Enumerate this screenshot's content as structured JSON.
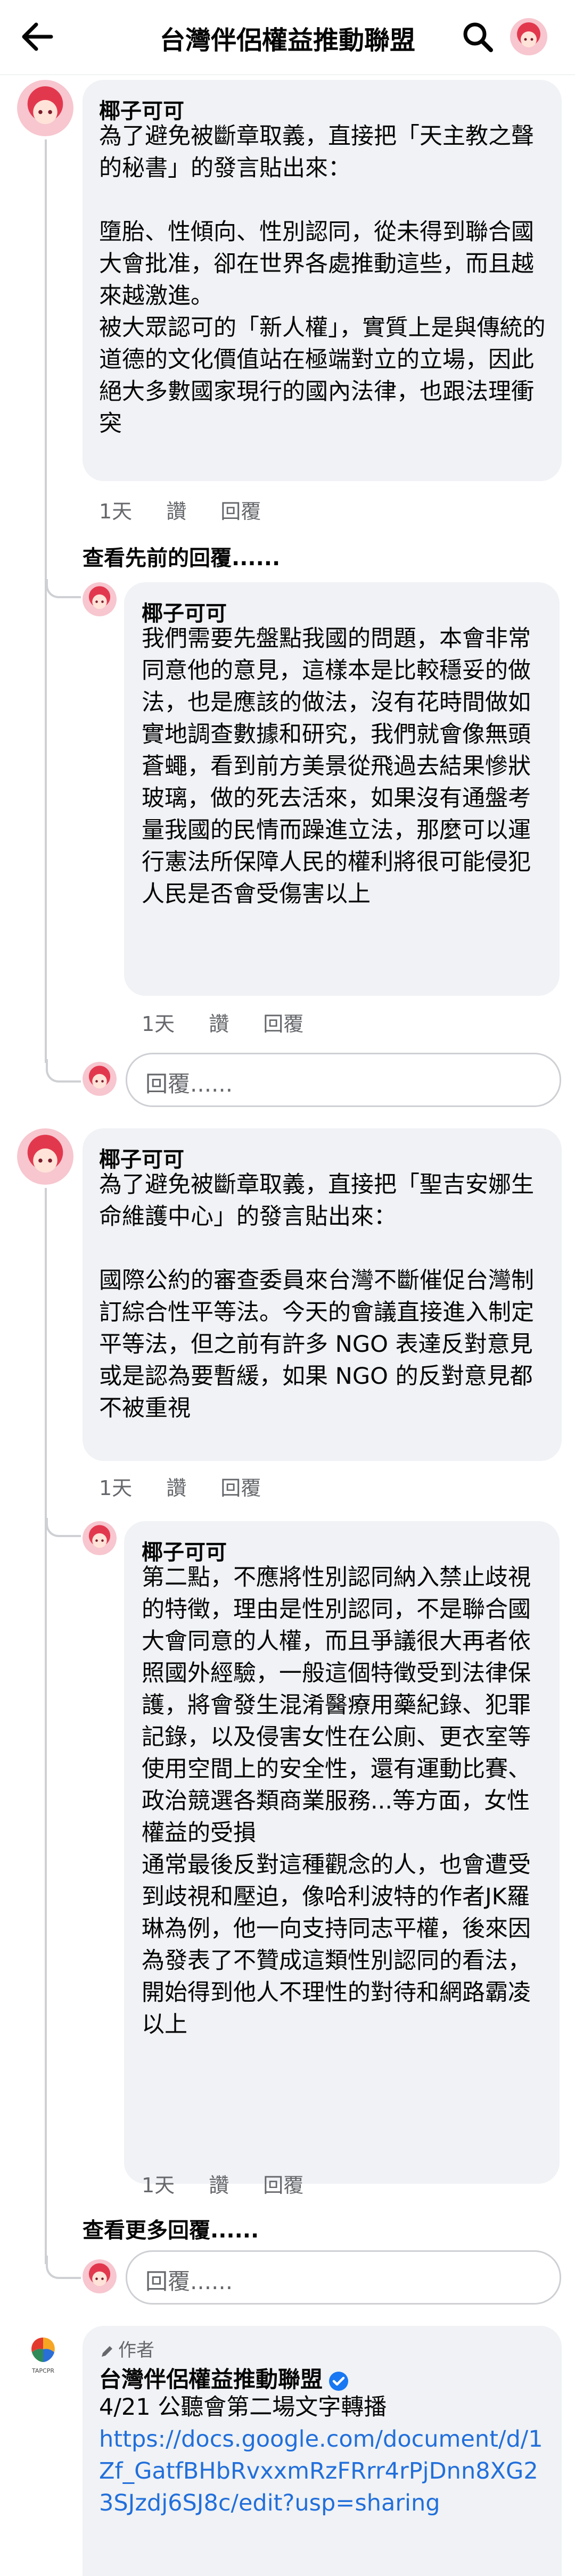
{
  "header": {
    "title": "台灣伴侶權益推動聯盟"
  },
  "comments": [
    {
      "author": "椰子可可",
      "paragraphs": [
        "為了避免被斷章取義，直接把「天主教之聲的秘書」的發言貼出來：",
        "墮胎、性傾向、性別認同，從未得到聯合國大會批准，卻在世界各處推動這些，而且越來越激進。",
        "被大眾認可的「新人權」，實質上是與傳統的道德的文化價值站在極端對立的立場，因此絕大多數國家現行的國內法律，也跟法理衝突"
      ],
      "time": "1天",
      "like": "讚",
      "reply": "回覆"
    },
    {
      "author": "椰子可可",
      "paragraphs": [
        "我們需要先盤點我國的問題，本會非常同意他的意見，這樣本是比較穩妥的做法，也是應該的做法，沒有花時間做如實地調查數據和研究，我們就會像無頭蒼蠅，看到前方美景從飛過去結果慘狀玻璃，做的死去活來，如果沒有通盤考量我國的民情而躁進立法，那麼可以運行憲法所保障人民的權利將很可能侵犯人民是否會受傷害以上"
      ],
      "time": "1天",
      "like": "讚",
      "reply": "回覆"
    },
    {
      "author": "椰子可可",
      "paragraphs": [
        "為了避免被斷章取義，直接把「聖吉安娜生命維護中心」的發言貼出來：",
        "國際公約的審查委員來台灣不斷催促台灣制訂綜合性平等法。今天的會議直接進入制定平等法，但之前有許多 NGO 表達反對意見或是認為要暫緩，如果 NGO 的反對意見都不被重視"
      ],
      "time": "1天",
      "like": "讚",
      "reply": "回覆"
    },
    {
      "author": "椰子可可",
      "paragraphs": [
        "第二點，不應將性別認同納入禁止歧視的特徵，理由是性別認同，不是聯合國大會同意的人權，而且爭議很大再者依照國外經驗，一般這個特徵受到法律保護，將會發生混淆醫療用藥紀錄、犯罪記錄，以及侵害女性在公廁、更衣室等使用空間上的安全性，還有運動比賽、政治競選各類商業服務...等方面，女性權益的受損",
        "通常最後反對這種觀念的人，也會遭受到歧視和壓迫，像哈利波特的作者JK羅琳為例，他一向支持同志平權，後來因為發表了不贊成這類性別認同的看法，開始得到他人不理性的對待和網路霸凌",
        "以上"
      ],
      "time": "1天",
      "like": "讚",
      "reply": "回覆"
    }
  ],
  "view_previous": "查看先前的回覆......",
  "view_more": "查看更多回覆......",
  "reply_placeholder": "回覆......",
  "author_post": {
    "tag": "作者",
    "name": "台灣伴侶權益推動聯盟",
    "line1": "4/21 公聽會第二場文字轉播",
    "link": "https://docs.google.com/document/d/1Zf_GatfBHbRvxxmRzFRrr4rPjDnn8XG23SJzdj6SJ8c/edit?usp=sharing",
    "logo_text": "TAPCPR"
  },
  "colors": {
    "link": "#216fdb",
    "bubble": "#f0f2f5",
    "verified": "#1877f2",
    "secondary": "#65676b"
  }
}
